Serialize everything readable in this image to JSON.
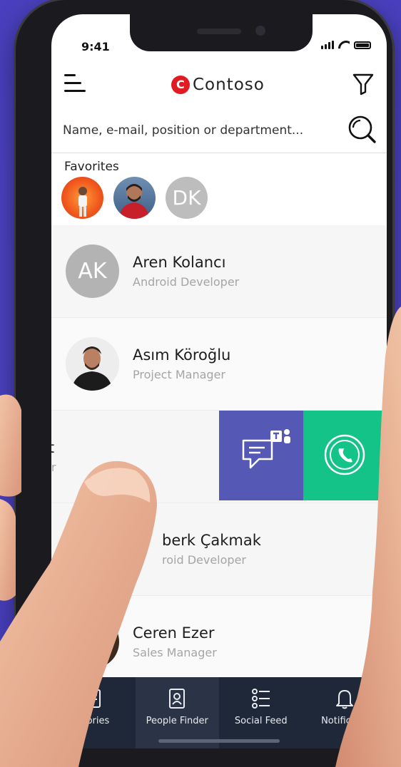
{
  "status": {
    "time": "9:41"
  },
  "header": {
    "brand": "Contoso",
    "brand_color": "#e11b22",
    "menu_icon": "menu-icon",
    "filter_icon": "filter-icon"
  },
  "search": {
    "placeholder": "Name, e-mail, position or department...",
    "icon": "search-icon"
  },
  "favorites": {
    "title": "Favorites",
    "items": [
      {
        "initials": "",
        "photo": "person-orange-bg"
      },
      {
        "initials": "",
        "photo": "person-red-shirt"
      },
      {
        "initials": "DK"
      }
    ]
  },
  "people": [
    {
      "name": "Aren Kolancı",
      "role": "Android Developer",
      "initials": "AK"
    },
    {
      "name": "Asım Köroğlu",
      "role": "Project Manager",
      "initials": ""
    },
    {
      "name": "it",
      "role": "er",
      "initials": ""
    },
    {
      "name": "berk Çakmak",
      "role": "roid Developer",
      "initials": ""
    },
    {
      "name": "Ceren Ezer",
      "role": "Sales Manager",
      "initials": ""
    }
  ],
  "swipe_actions": {
    "teams_color": "#5558b5",
    "call_color": "#13c387",
    "teams_icon": "teams-chat-icon",
    "call_icon": "phone-call-icon"
  },
  "nav": {
    "items": [
      {
        "label": "Stories",
        "icon": "stories-icon"
      },
      {
        "label": "People Finder",
        "icon": "people-finder-icon"
      },
      {
        "label": "Social Feed",
        "icon": "social-feed-icon"
      },
      {
        "label": "Notificatio",
        "icon": "bell-icon"
      }
    ],
    "active": "People Finder"
  }
}
